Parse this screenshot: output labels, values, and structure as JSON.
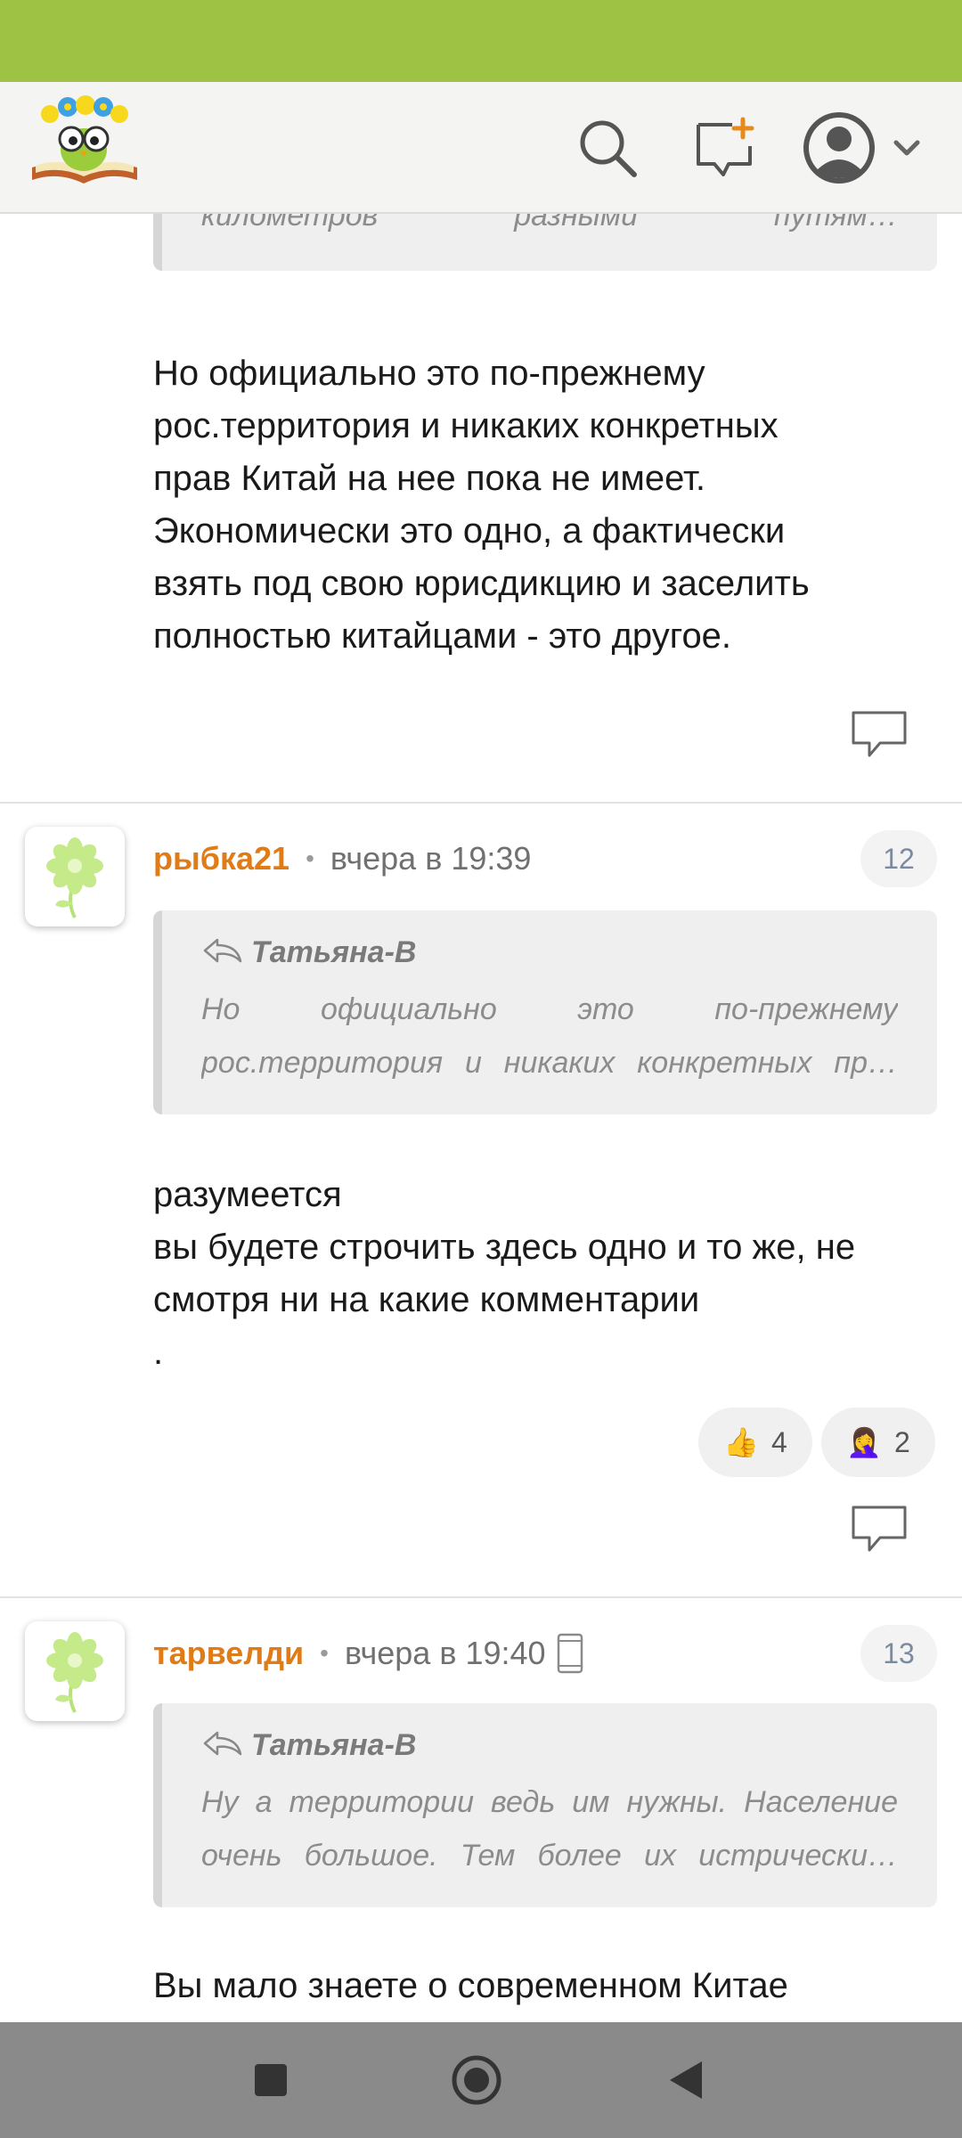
{
  "header": {
    "logo_name": "book-owl-logo",
    "search_icon": "search-icon",
    "new_message_icon": "new-message-icon",
    "profile_icon": "user-avatar-icon"
  },
  "top_partial": {
    "quote_text": "километров разными путям…",
    "body": [
      "Но официально это по-прежнему",
      "рос.территория и никаких конкретных",
      "прав Китай на нее пока не имеет.",
      "Экономически это одно, а фактически",
      "взять под свою юрисдикцию и заселить",
      "полностью китайцами - это другое."
    ]
  },
  "comments": [
    {
      "username": "рыбка21",
      "separator": "•",
      "time": "вчера в 19:39",
      "number": "12",
      "quote_author": "Татьяна-В",
      "quote_lines": [
        "Но официально это по-прежнему",
        "рос.территория и никаких конкретных пр…"
      ],
      "body": [
        "разумеется",
        "вы будете строчить здесь одно и то же, не",
        "смотря ни на какие комментарии",
        "."
      ],
      "reactions": [
        {
          "emoji": "👍",
          "count": "4"
        },
        {
          "emoji": "🤦‍♀️",
          "count": "2"
        }
      ]
    },
    {
      "username": "тарвелди",
      "separator": "•",
      "time": "вчера в 19:40",
      "number": "13",
      "quote_author": "Татьяна-В",
      "quote_lines": [
        "Ну а территории ведь им нужны. Население",
        "очень большое. Тем более их истрически…"
      ],
      "body": [
        "Вы мало знаете о современном Китае"
      ]
    }
  ],
  "colors": {
    "status_bar": "#9dc244",
    "username": "#e07b16",
    "nav_bar": "#8a8a8a"
  }
}
